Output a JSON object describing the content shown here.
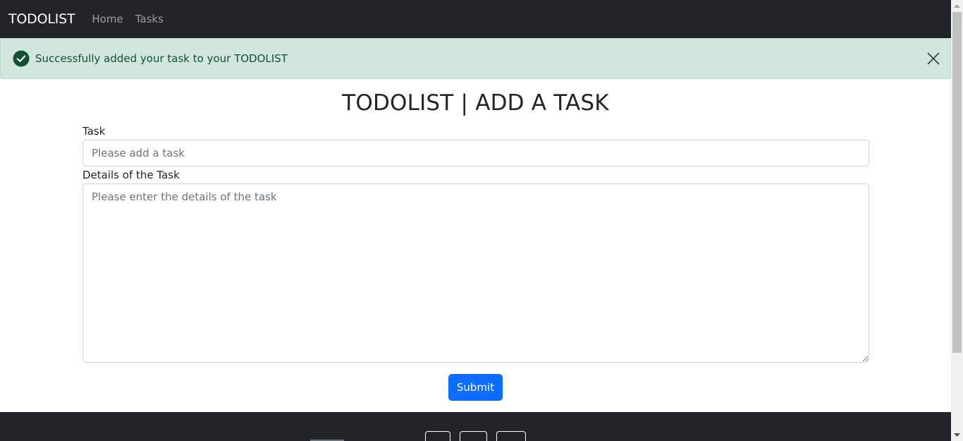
{
  "navbar": {
    "brand": "TODOLIST",
    "links": [
      {
        "label": "Home"
      },
      {
        "label": "Tasks"
      }
    ]
  },
  "alert": {
    "message": "Successfully added your task to your TODOLIST",
    "icon": "check-circle-icon",
    "close_icon": "close-icon",
    "colors": {
      "background": "#d1e7dd",
      "text": "#0f5132"
    }
  },
  "main": {
    "title": "TODOLIST | ADD A TASK",
    "task_label": "Task",
    "task_placeholder": "Please add a task",
    "task_value": "",
    "details_label": "Details of the Task",
    "details_placeholder": "Please enter the details of the task",
    "details_value": "",
    "submit_label": "Submit"
  },
  "colors": {
    "navbar_bg": "#212529",
    "primary": "#0d6efd",
    "footer_bg": "#212529"
  }
}
